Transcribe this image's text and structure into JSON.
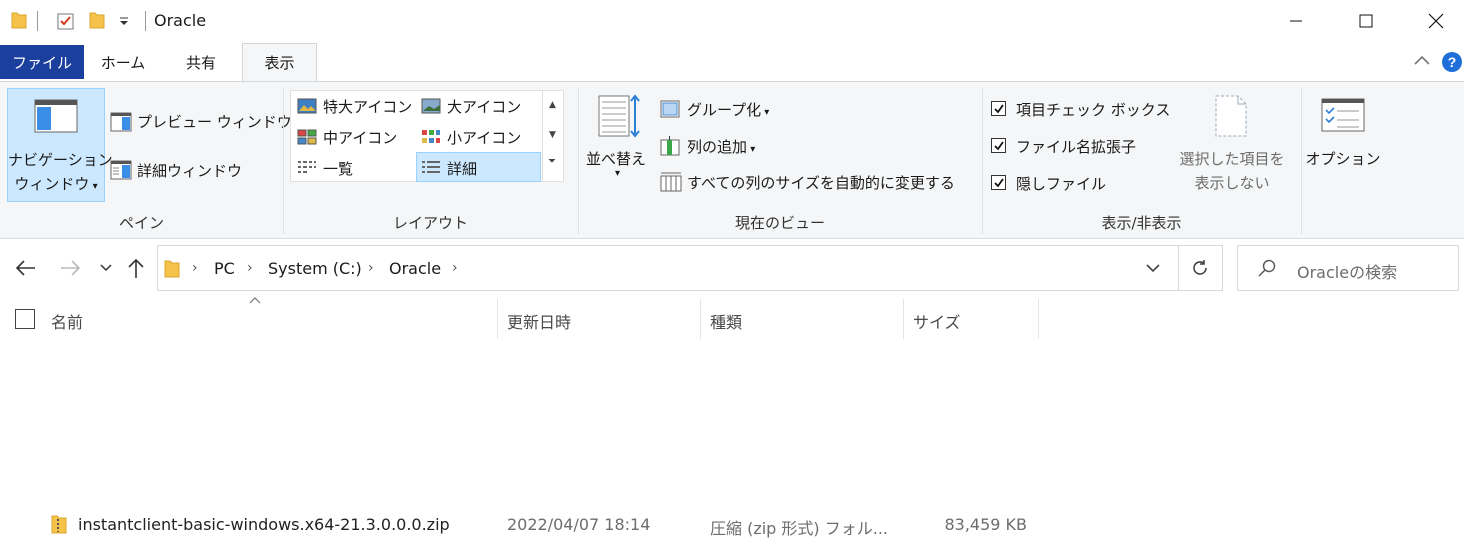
{
  "window": {
    "title": "Oracle"
  },
  "tabs": [
    {
      "label": "ファイル"
    },
    {
      "label": "ホーム"
    },
    {
      "label": "共有"
    },
    {
      "label": "表示"
    }
  ],
  "ribbon": {
    "pane": {
      "nav_line1": "ナビゲーション",
      "nav_line2": "ウィンドウ",
      "preview": "プレビュー ウィンドウ",
      "details": "詳細ウィンドウ",
      "label": "ペイン"
    },
    "layout": {
      "xl_icons": "特大アイコン",
      "l_icons": "大アイコン",
      "m_icons": "中アイコン",
      "s_icons": "小アイコン",
      "list": "一覧",
      "details": "詳細",
      "label": "レイアウト"
    },
    "current_view": {
      "sort": "並べ替え",
      "group": "グループ化",
      "add_column": "列の追加",
      "fit_columns": "すべての列のサイズを自動的に変更する",
      "label": "現在のビュー"
    },
    "show_hide": {
      "item_checkboxes": "項目チェック ボックス",
      "extensions": "ファイル名拡張子",
      "hidden": "隠しファイル",
      "hide_selected_line1": "選択した項目を",
      "hide_selected_line2": "表示しない",
      "label": "表示/非表示"
    },
    "options": {
      "label": "オプション"
    }
  },
  "address": {
    "crumbs": [
      "PC",
      "System (C:)",
      "Oracle"
    ],
    "search_placeholder": "Oracleの検索"
  },
  "columns": {
    "name": "名前",
    "modified": "更新日時",
    "type": "種類",
    "size": "サイズ"
  },
  "files": [
    {
      "name": "instantclient-basic-windows.x64-21.3.0.0.0.zip",
      "modified": "2022/04/07 18:14",
      "type": "圧縮 (zip 形式) フォル...",
      "size": "83,459 KB"
    }
  ],
  "colors": {
    "file_tab": "#1a3f9c",
    "ribbon_bg": "#f5f6f7",
    "selected": "#cce8ff",
    "selected_border": "#99d1ff",
    "help": "#1e6fd9"
  }
}
